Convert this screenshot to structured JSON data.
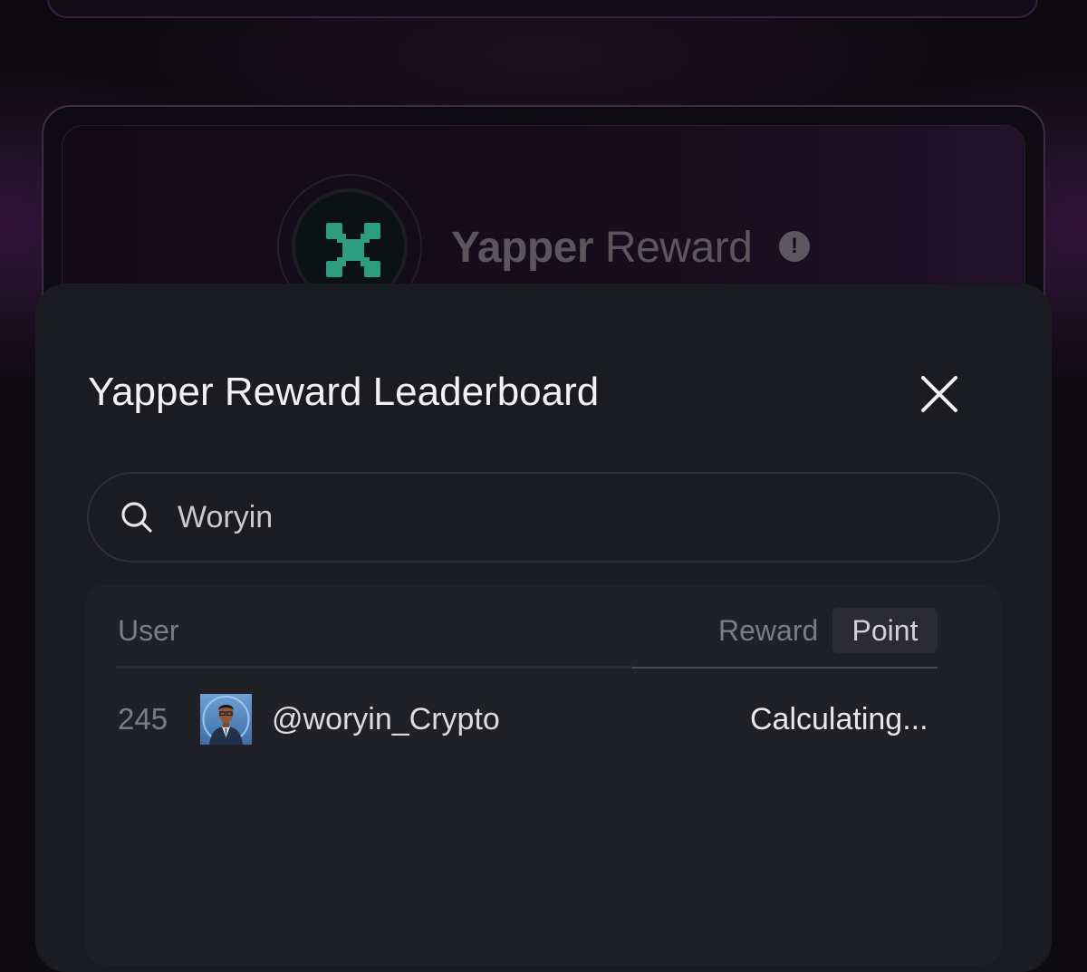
{
  "background_card": {
    "title_bold": "Yapper",
    "title_rest": "Reward",
    "info_icon": "!"
  },
  "modal": {
    "title": "Yapper Reward Leaderboard",
    "close_icon": "close-icon"
  },
  "search": {
    "value": "Woryin",
    "icon": "search-icon"
  },
  "table": {
    "columns": {
      "user": "User",
      "reward": "Reward",
      "point": "Point"
    },
    "active_tab": "Point",
    "rows": [
      {
        "rank": "245",
        "handle": "@woryin_Crypto",
        "reward": "Calculating..."
      }
    ]
  },
  "colors": {
    "page_bg": "#0c0a0e",
    "modal_bg": "#1b1c21",
    "panel_bg": "#202127",
    "logo_accent": "#2d9c7f",
    "muted_text": "#7b7c84",
    "title_text": "#f2f2f4"
  }
}
